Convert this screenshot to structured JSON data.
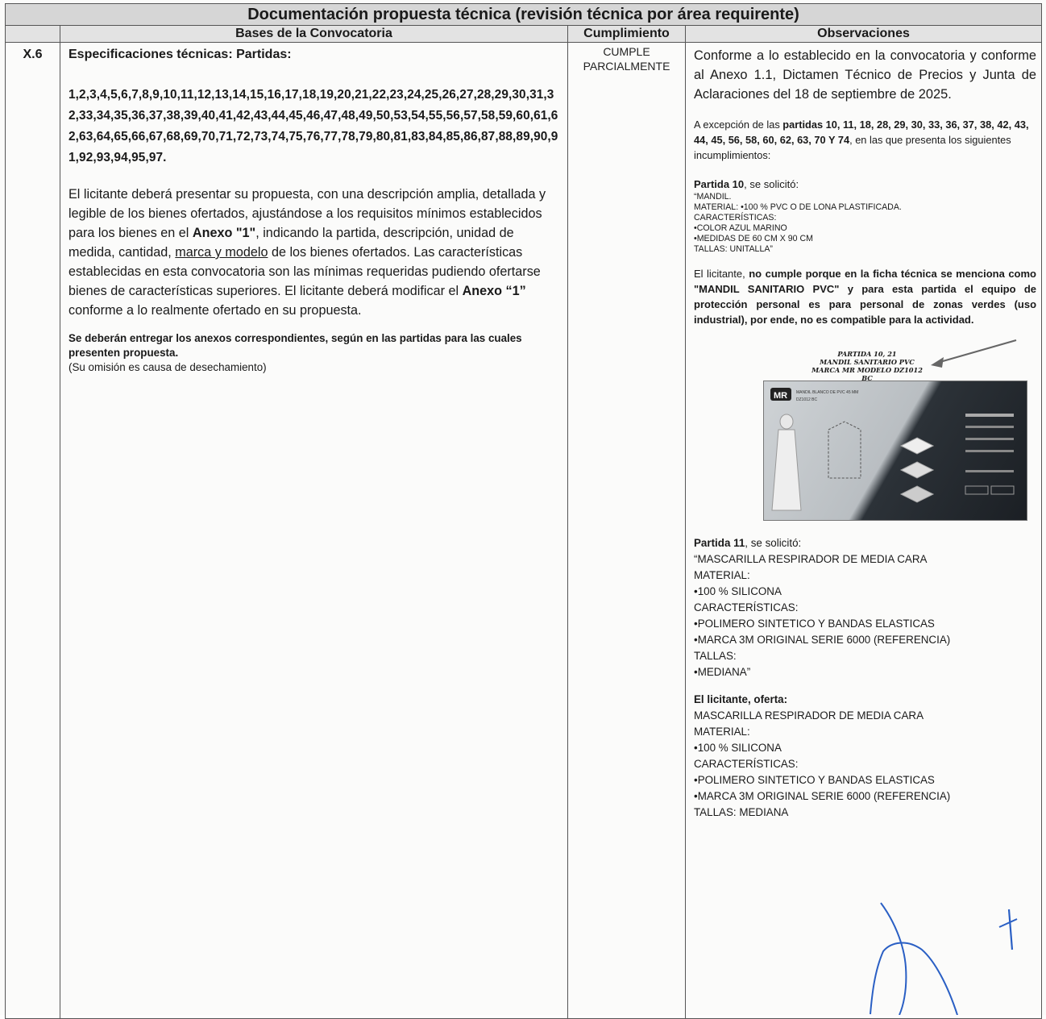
{
  "header": {
    "title": "Documentación propuesta técnica (revisión técnica por área requirente)",
    "col_bases": "Bases de la Convocatoria",
    "col_cumplimiento": "Cumplimiento",
    "col_observaciones": "Observaciones"
  },
  "row": {
    "number": "X.6",
    "spec_title": "Especificaciones técnicas: Partidas:",
    "partidas_list": "1,2,3,4,5,6,7,8,9,10,11,12,13,14,15,16,17,18,19,20,21,22,23,24,25,26,27,28,29,30,31,32,33,34,35,36,37,38,39,40,41,42,43,44,45,46,47,48,49,50,53,54,55,56,57,58,59,60,61,62,63,64,65,66,67,68,69,70,71,72,73,74,75,76,77,78,79,80,81,83,84,85,86,87,88,89,90,91,92,93,94,95,97.",
    "body": {
      "t1": "El licitante deberá presentar su propuesta, con una descripción amplia, detallada y legible de los bienes ofertados, ajustándose a los requisitos mínimos establecidos para los bienes en el ",
      "b1": "Anexo \"1\"",
      "t2": ", indicando la partida, descripción, unidad de medida, cantidad, ",
      "u1": "marca y modelo",
      "t3": " de los bienes ofertados. Las características establecidas en esta convocatoria son las mínimas requeridas pudiendo ofertarse bienes de características superiores. El licitante deberá modificar el ",
      "b2": "Anexo “1”",
      "t4": " conforme a lo realmente ofertado en su propuesta."
    },
    "anexos_note": "Se deberán entregar los anexos correspondientes, según en las partidas para las cuales presenten propuesta.",
    "omission_note": "(Su omisión es causa de desechamiento)",
    "cumplimiento": "CUMPLE PARCIALMENTE",
    "observaciones": {
      "intro": "Conforme a lo establecido en la convocatoria y conforme al Anexo 1.1, Dictamen Técnico de Precios y Junta de Aclaraciones del 18 de septiembre de 2025.",
      "exception_pre": "A excepción de las ",
      "exception_bold": "partidas 10, 11, 18, 28, 29, 30, 33, 36, 37, 38, 42, 43, 44, 45, 56, 58, 60, 62, 63, 70 Y 74",
      "exception_post": ", en las que presenta los siguientes incumplimientos:",
      "p10_bold": "Partida 10",
      "p10_rest": ", se solicitó:",
      "p10_requested": "“MANDIL.\nMATERIAL: •100 % PVC O DE LONA PLASTIFICADA.\nCARACTERÍSTICAS:\n•COLOR AZUL MARINO\n•MEDIDAS DE 60 CM X 90 CM\nTALLAS: UNITALLA”",
      "p10_note_pre": "El licitante, ",
      "p10_note_bold": "no cumple porque en la ficha técnica se menciona como \"MANDIL SANITARIO PVC\" y para esta partida el equipo de protección personal es para personal de zonas verdes (uso industrial), por ende, no es compatible para la actividad.",
      "figure_caption_1": "PARTIDA 10, 21",
      "figure_caption_2": "MANDIL SANITARIO PVC",
      "figure_caption_3": "MARCA MR MODELO DZ1012 BC",
      "figure_logo": "MR",
      "figure_product": "MANDIL BLANCO DE PVC 45 MM",
      "figure_model": "DZ1012 BC",
      "p11_bold": "Partida 11",
      "p11_rest": ", se solicitó:",
      "p11_requested": "“MASCARILLA RESPIRADOR DE MEDIA CARA\nMATERIAL:\n•100 % SILICONA\nCARACTERÍSTICAS:\n•POLIMERO SINTETICO Y BANDAS ELASTICAS\n•MARCA 3M ORIGINAL SERIE 6000 (REFERENCIA)\nTALLAS:\n•MEDIANA”",
      "offer_head": "El licitante, oferta:",
      "offer_body": "MASCARILLA RESPIRADOR DE MEDIA CARA\nMATERIAL:\n•100 % SILICONA\nCARACTERÍSTICAS:\n•POLIMERO SINTETICO Y BANDAS ELASTICAS\n•MARCA 3M ORIGINAL SERIE 6000 (REFERENCIA)\nTALLAS: MEDIANA"
    }
  },
  "colors": {
    "header_bg": "#d6d6d6",
    "subheader_bg": "#e3e3e3",
    "ink_blue": "#2a5fc4",
    "border": "#555555"
  }
}
